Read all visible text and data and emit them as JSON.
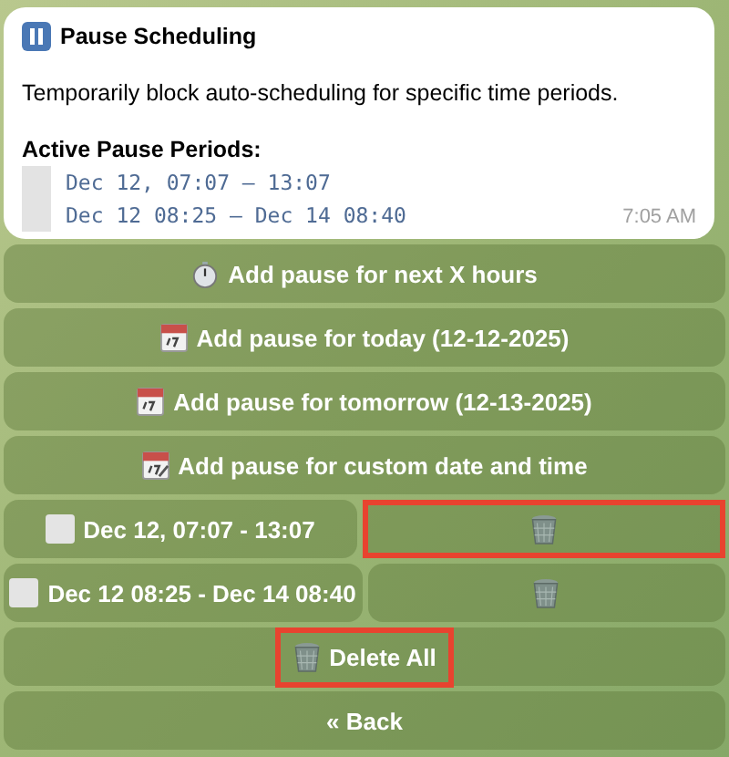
{
  "message": {
    "title": "Pause Scheduling",
    "description": "Temporarily block auto-scheduling for specific time periods.",
    "periods_heading": "Active Pause Periods:",
    "periods": [
      "Dec 12, 07:07 – 13:07",
      "Dec 12 08:25 – Dec 14 08:40"
    ],
    "time": "7:05 AM"
  },
  "keyboard": [
    [
      {
        "label": "Add pause for next X hours",
        "kind": "stopwatch",
        "highlighted": false
      }
    ],
    [
      {
        "label": "Add pause for today (12-12-2025)",
        "kind": "calendar",
        "highlighted": false
      }
    ],
    [
      {
        "label": "Add pause for tomorrow (12-13-2025)",
        "kind": "calendar",
        "highlighted": false
      }
    ],
    [
      {
        "label": "Add pause for custom date and time",
        "kind": "calendar-pen",
        "highlighted": false
      }
    ],
    [
      {
        "label": "Dec 12, 07:07 - 13:07",
        "kind": "square",
        "highlighted": false
      },
      {
        "kind": "trash",
        "highlighted": true
      }
    ],
    [
      {
        "label": "Dec 12 08:25 - Dec 14 08:40",
        "kind": "square",
        "highlighted": false
      },
      {
        "kind": "trash",
        "highlighted": false
      }
    ],
    [
      {
        "label": "Delete All",
        "kind": "trash",
        "highlighted": true
      }
    ],
    [
      {
        "label": "« Back",
        "highlighted": false
      }
    ]
  ]
}
